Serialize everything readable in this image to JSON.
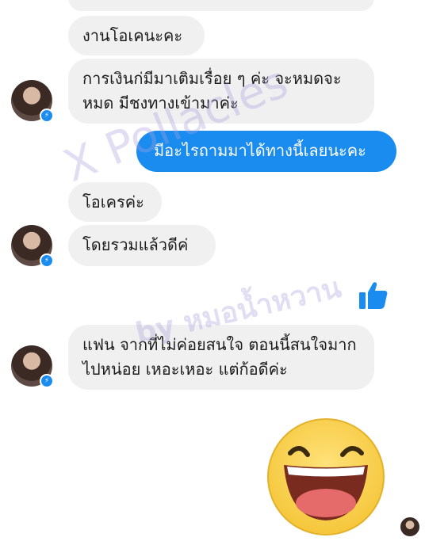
{
  "messages": [
    {
      "text": "งานโอเคนะคะ"
    },
    {
      "text": "การเงินก่มีมาเติมเรื่อย ๆ ค่ะ จะหมดจะหมด มีชงทางเข้ามาค่ะ"
    },
    {
      "text": "มีอะไรถามมาได้ทางนี้เลยนะคะ"
    },
    {
      "text": "โอเครค่ะ"
    },
    {
      "text": "โดยรวมแล้วดีค่"
    },
    {
      "text": "แฟน จากที่ไม่ค่อยสนใจ ตอนนี้สนใจมากไปหน่อย เหอะเหอะ แต่ก้อดีค่ะ"
    }
  ],
  "watermarks": {
    "brand": "X Pollacles",
    "credit": "by หมอน้ำหวาน"
  },
  "colors": {
    "outgoing_bubble": "#1a8cf0",
    "incoming_bubble": "#f0f0f0",
    "like_icon": "#1a8cf0"
  },
  "icons": {
    "like": "thumbs-up-icon",
    "sticker": "laughing-smiley-sticker",
    "messenger_badge": "messenger-icon"
  }
}
